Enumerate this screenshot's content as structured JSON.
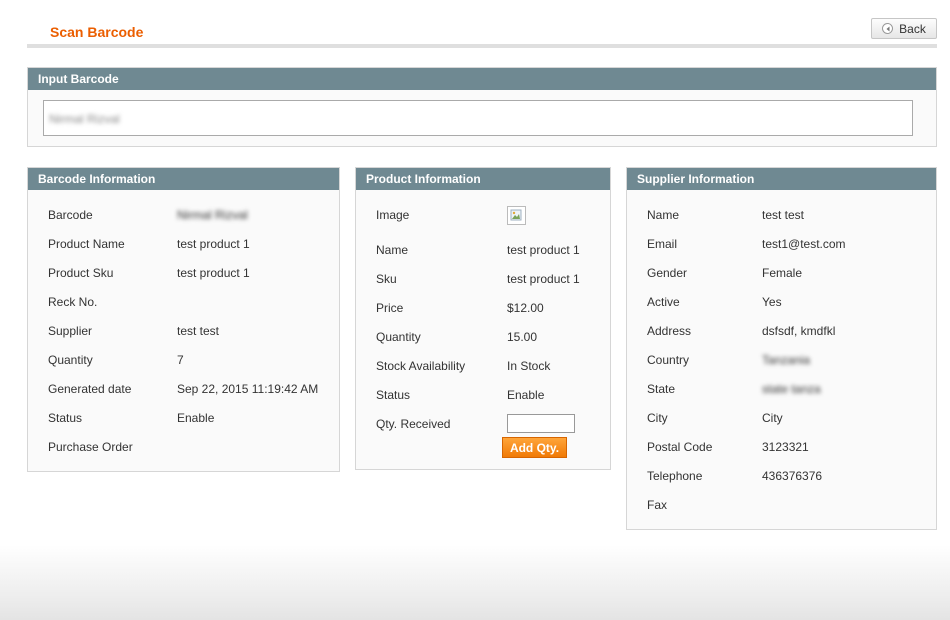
{
  "header": {
    "title": "Scan Barcode",
    "back_label": "Back"
  },
  "input_section": {
    "title": "Input Barcode",
    "value": "Nirmal Rizval"
  },
  "barcode_info": {
    "title": "Barcode Information",
    "rows": [
      {
        "label": "Barcode",
        "value": "Nirmal Rizval"
      },
      {
        "label": "Product Name",
        "value": "test product 1"
      },
      {
        "label": "Product Sku",
        "value": "test product 1"
      },
      {
        "label": "Reck No.",
        "value": ""
      },
      {
        "label": "Supplier",
        "value": "test test"
      },
      {
        "label": "Quantity",
        "value": "7"
      },
      {
        "label": "Generated date",
        "value": "Sep 22, 2015 11:19:42 AM"
      },
      {
        "label": "Status",
        "value": "Enable"
      },
      {
        "label": "Purchase Order",
        "value": ""
      }
    ]
  },
  "product_info": {
    "title": "Product Information",
    "image_label": "Image",
    "rows": [
      {
        "label": "Name",
        "value": "test product 1"
      },
      {
        "label": "Sku",
        "value": "test product 1"
      },
      {
        "label": "Price",
        "value": "$12.00"
      },
      {
        "label": "Quantity",
        "value": "15.00"
      },
      {
        "label": "Stock Availability",
        "value": "In Stock"
      },
      {
        "label": "Status",
        "value": "Enable"
      }
    ],
    "qty_received_label": "Qty. Received",
    "add_qty_label": "Add Qty."
  },
  "supplier_info": {
    "title": "Supplier Information",
    "rows": [
      {
        "label": "Name",
        "value": "test test"
      },
      {
        "label": "Email",
        "value": "test1@test.com"
      },
      {
        "label": "Gender",
        "value": "Female"
      },
      {
        "label": "Active",
        "value": "Yes"
      },
      {
        "label": "Address",
        "value": "dsfsdf, kmdfkl"
      },
      {
        "label": "Country",
        "value": "Tanzania"
      },
      {
        "label": "State",
        "value": "state tanza"
      },
      {
        "label": "City",
        "value": "City"
      },
      {
        "label": "Postal Code",
        "value": "3123321"
      },
      {
        "label": "Telephone",
        "value": "436376376"
      },
      {
        "label": "Fax",
        "value": ""
      }
    ]
  }
}
